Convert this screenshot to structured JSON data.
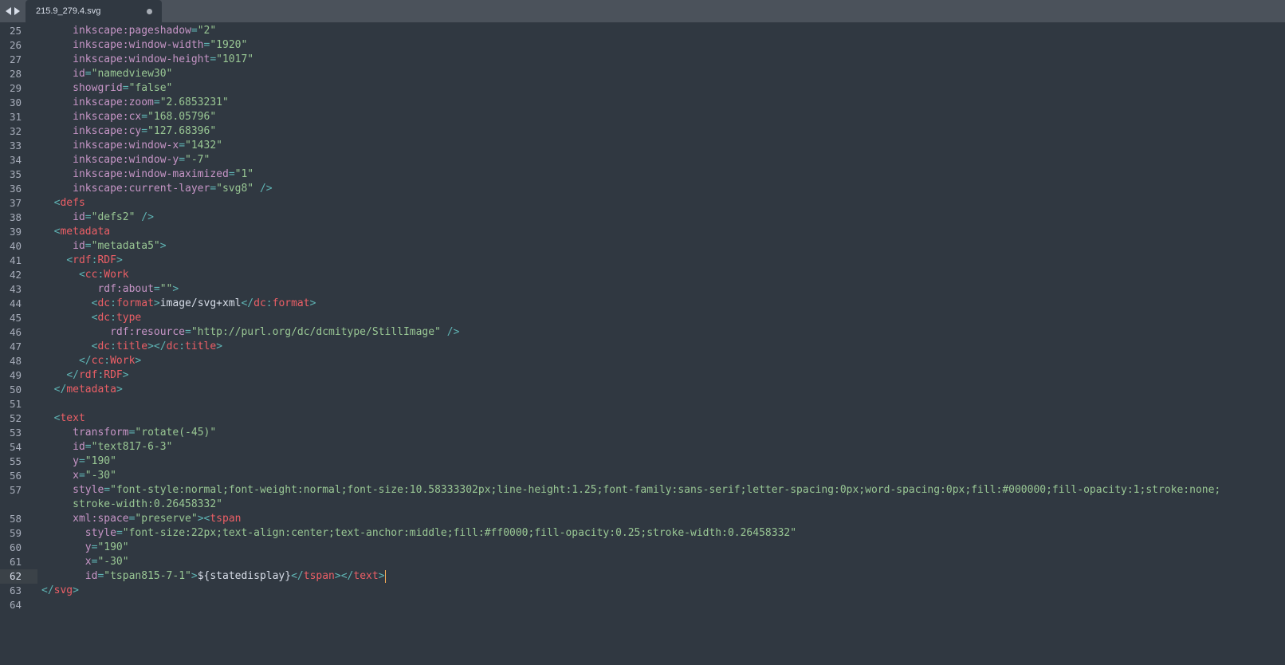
{
  "tab": {
    "filename": "215.9_279.4.svg"
  },
  "colors": {
    "background": "#303841",
    "tabbar": "#4b525b",
    "tag": "#ec5f66",
    "attribute": "#c695c6",
    "string": "#99c794",
    "punctuation": "#5fb4b4",
    "text": "#d8dee9",
    "caret": "#f9ae58"
  },
  "lines": [
    {
      "num": "25",
      "indent": "     ",
      "tokens": [
        [
          "attr",
          "inkscape:pageshadow"
        ],
        [
          "punc",
          "="
        ],
        [
          "str",
          "\"2\""
        ]
      ]
    },
    {
      "num": "26",
      "indent": "     ",
      "tokens": [
        [
          "attr",
          "inkscape:window-width"
        ],
        [
          "punc",
          "="
        ],
        [
          "str",
          "\"1920\""
        ]
      ]
    },
    {
      "num": "27",
      "indent": "     ",
      "tokens": [
        [
          "attr",
          "inkscape:window-height"
        ],
        [
          "punc",
          "="
        ],
        [
          "str",
          "\"1017\""
        ]
      ]
    },
    {
      "num": "28",
      "indent": "     ",
      "tokens": [
        [
          "attr",
          "id"
        ],
        [
          "punc",
          "="
        ],
        [
          "str",
          "\"namedview30\""
        ]
      ]
    },
    {
      "num": "29",
      "indent": "     ",
      "tokens": [
        [
          "attr",
          "showgrid"
        ],
        [
          "punc",
          "="
        ],
        [
          "str",
          "\"false\""
        ]
      ]
    },
    {
      "num": "30",
      "indent": "     ",
      "tokens": [
        [
          "attr",
          "inkscape:zoom"
        ],
        [
          "punc",
          "="
        ],
        [
          "str",
          "\"2.6853231\""
        ]
      ]
    },
    {
      "num": "31",
      "indent": "     ",
      "tokens": [
        [
          "attr",
          "inkscape:cx"
        ],
        [
          "punc",
          "="
        ],
        [
          "str",
          "\"168.05796\""
        ]
      ]
    },
    {
      "num": "32",
      "indent": "     ",
      "tokens": [
        [
          "attr",
          "inkscape:cy"
        ],
        [
          "punc",
          "="
        ],
        [
          "str",
          "\"127.68396\""
        ]
      ]
    },
    {
      "num": "33",
      "indent": "     ",
      "tokens": [
        [
          "attr",
          "inkscape:window-x"
        ],
        [
          "punc",
          "="
        ],
        [
          "str",
          "\"1432\""
        ]
      ]
    },
    {
      "num": "34",
      "indent": "     ",
      "tokens": [
        [
          "attr",
          "inkscape:window-y"
        ],
        [
          "punc",
          "="
        ],
        [
          "str",
          "\"-7\""
        ]
      ]
    },
    {
      "num": "35",
      "indent": "     ",
      "tokens": [
        [
          "attr",
          "inkscape:window-maximized"
        ],
        [
          "punc",
          "="
        ],
        [
          "str",
          "\"1\""
        ]
      ]
    },
    {
      "num": "36",
      "indent": "     ",
      "tokens": [
        [
          "attr",
          "inkscape:current-layer"
        ],
        [
          "punc",
          "="
        ],
        [
          "str",
          "\"svg8\""
        ],
        [
          "punc",
          " />"
        ]
      ]
    },
    {
      "num": "37",
      "indent": "  ",
      "tokens": [
        [
          "punc",
          "<"
        ],
        [
          "tag",
          "defs"
        ]
      ]
    },
    {
      "num": "38",
      "indent": "     ",
      "tokens": [
        [
          "attr",
          "id"
        ],
        [
          "punc",
          "="
        ],
        [
          "str",
          "\"defs2\""
        ],
        [
          "punc",
          " />"
        ]
      ]
    },
    {
      "num": "39",
      "indent": "  ",
      "tokens": [
        [
          "punc",
          "<"
        ],
        [
          "tag",
          "metadata"
        ]
      ]
    },
    {
      "num": "40",
      "indent": "     ",
      "tokens": [
        [
          "attr",
          "id"
        ],
        [
          "punc",
          "="
        ],
        [
          "str",
          "\"metadata5\""
        ],
        [
          "punc",
          ">"
        ]
      ]
    },
    {
      "num": "41",
      "indent": "    ",
      "tokens": [
        [
          "punc",
          "<"
        ],
        [
          "tag",
          "rdf"
        ],
        [
          "punc",
          ":"
        ],
        [
          "tag",
          "RDF"
        ],
        [
          "punc",
          ">"
        ]
      ]
    },
    {
      "num": "42",
      "indent": "      ",
      "tokens": [
        [
          "punc",
          "<"
        ],
        [
          "tag",
          "cc"
        ],
        [
          "punc",
          ":"
        ],
        [
          "tag",
          "Work"
        ]
      ]
    },
    {
      "num": "43",
      "indent": "         ",
      "tokens": [
        [
          "attr",
          "rdf:about"
        ],
        [
          "punc",
          "="
        ],
        [
          "str",
          "\"\""
        ],
        [
          "punc",
          ">"
        ]
      ]
    },
    {
      "num": "44",
      "indent": "        ",
      "tokens": [
        [
          "punc",
          "<"
        ],
        [
          "tag",
          "dc"
        ],
        [
          "punc",
          ":"
        ],
        [
          "tag",
          "format"
        ],
        [
          "punc",
          ">"
        ],
        [
          "text",
          "image/svg+xml"
        ],
        [
          "punc",
          "</"
        ],
        [
          "tag",
          "dc"
        ],
        [
          "punc",
          ":"
        ],
        [
          "tag",
          "format"
        ],
        [
          "punc",
          ">"
        ]
      ]
    },
    {
      "num": "45",
      "indent": "        ",
      "tokens": [
        [
          "punc",
          "<"
        ],
        [
          "tag",
          "dc"
        ],
        [
          "punc",
          ":"
        ],
        [
          "tag",
          "type"
        ]
      ]
    },
    {
      "num": "46",
      "indent": "           ",
      "tokens": [
        [
          "attr",
          "rdf:resource"
        ],
        [
          "punc",
          "="
        ],
        [
          "str",
          "\"http://purl.org/dc/dcmitype/StillImage\""
        ],
        [
          "punc",
          " />"
        ]
      ]
    },
    {
      "num": "47",
      "indent": "        ",
      "tokens": [
        [
          "punc",
          "<"
        ],
        [
          "tag",
          "dc"
        ],
        [
          "punc",
          ":"
        ],
        [
          "tag",
          "title"
        ],
        [
          "punc",
          "></"
        ],
        [
          "tag",
          "dc"
        ],
        [
          "punc",
          ":"
        ],
        [
          "tag",
          "title"
        ],
        [
          "punc",
          ">"
        ]
      ]
    },
    {
      "num": "48",
      "indent": "      ",
      "tokens": [
        [
          "punc",
          "</"
        ],
        [
          "tag",
          "cc"
        ],
        [
          "punc",
          ":"
        ],
        [
          "tag",
          "Work"
        ],
        [
          "punc",
          ">"
        ]
      ]
    },
    {
      "num": "49",
      "indent": "    ",
      "tokens": [
        [
          "punc",
          "</"
        ],
        [
          "tag",
          "rdf"
        ],
        [
          "punc",
          ":"
        ],
        [
          "tag",
          "RDF"
        ],
        [
          "punc",
          ">"
        ]
      ]
    },
    {
      "num": "50",
      "indent": "  ",
      "tokens": [
        [
          "punc",
          "</"
        ],
        [
          "tag",
          "metadata"
        ],
        [
          "punc",
          ">"
        ]
      ]
    },
    {
      "num": "51",
      "indent": "",
      "tokens": []
    },
    {
      "num": "52",
      "indent": "  ",
      "tokens": [
        [
          "punc",
          "<"
        ],
        [
          "tag",
          "text"
        ]
      ]
    },
    {
      "num": "53",
      "indent": "     ",
      "tokens": [
        [
          "attr",
          "transform"
        ],
        [
          "punc",
          "="
        ],
        [
          "str",
          "\"rotate(-45)\""
        ]
      ]
    },
    {
      "num": "54",
      "indent": "     ",
      "tokens": [
        [
          "attr",
          "id"
        ],
        [
          "punc",
          "="
        ],
        [
          "str",
          "\"text817-6-3\""
        ]
      ]
    },
    {
      "num": "55",
      "indent": "     ",
      "tokens": [
        [
          "attr",
          "y"
        ],
        [
          "punc",
          "="
        ],
        [
          "str",
          "\"190\""
        ]
      ]
    },
    {
      "num": "56",
      "indent": "     ",
      "tokens": [
        [
          "attr",
          "x"
        ],
        [
          "punc",
          "="
        ],
        [
          "str",
          "\"-30\""
        ]
      ]
    },
    {
      "num": "57",
      "indent": "     ",
      "tokens": [
        [
          "attr",
          "style"
        ],
        [
          "punc",
          "="
        ],
        [
          "str",
          "\"font-style:normal;font-weight:normal;font-size:10.58333302px;line-height:1.25;font-family:sans-serif;letter-spacing:0px;word-spacing:0px;fill:#000000;fill-opacity:1;stroke:none;"
        ]
      ]
    },
    {
      "num": "",
      "indent": "     ",
      "tokens": [
        [
          "str",
          "stroke-width:0.26458332\""
        ]
      ]
    },
    {
      "num": "58",
      "indent": "     ",
      "tokens": [
        [
          "attr",
          "xml:space"
        ],
        [
          "punc",
          "="
        ],
        [
          "str",
          "\"preserve\""
        ],
        [
          "punc",
          "><"
        ],
        [
          "tag",
          "tspan"
        ]
      ]
    },
    {
      "num": "59",
      "indent": "       ",
      "tokens": [
        [
          "attr",
          "style"
        ],
        [
          "punc",
          "="
        ],
        [
          "str",
          "\"font-size:22px;text-align:center;text-anchor:middle;fill:#ff0000;fill-opacity:0.25;stroke-width:0.26458332\""
        ]
      ]
    },
    {
      "num": "60",
      "indent": "       ",
      "tokens": [
        [
          "attr",
          "y"
        ],
        [
          "punc",
          "="
        ],
        [
          "str",
          "\"190\""
        ]
      ]
    },
    {
      "num": "61",
      "indent": "       ",
      "tokens": [
        [
          "attr",
          "x"
        ],
        [
          "punc",
          "="
        ],
        [
          "str",
          "\"-30\""
        ]
      ]
    },
    {
      "num": "62",
      "indent": "       ",
      "active": true,
      "tokens": [
        [
          "attr",
          "id"
        ],
        [
          "punc",
          "="
        ],
        [
          "str",
          "\"tspan815-7-1\""
        ],
        [
          "punc",
          ">"
        ],
        [
          "text",
          "${statedisplay}"
        ],
        [
          "punc",
          "</"
        ],
        [
          "tag",
          "tspan"
        ],
        [
          "punc",
          "></"
        ],
        [
          "tag",
          "text"
        ],
        [
          "punc",
          ">"
        ]
      ]
    },
    {
      "num": "63",
      "indent": "",
      "tokens": [
        [
          "punc",
          "</"
        ],
        [
          "tag",
          "svg"
        ],
        [
          "punc",
          ">"
        ]
      ]
    },
    {
      "num": "64",
      "indent": "",
      "tokens": []
    }
  ]
}
